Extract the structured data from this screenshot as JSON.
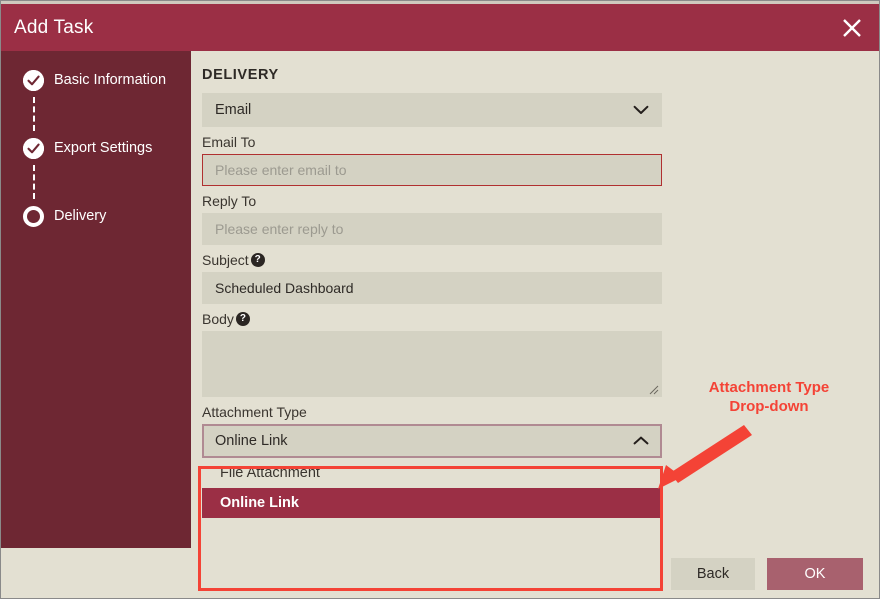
{
  "window": {
    "title": "Add Task",
    "close_icon": "close-icon",
    "bg_ghost_text": "· · ·   · ·"
  },
  "sidebar": {
    "steps": [
      {
        "label": "Basic Information",
        "state": "completed",
        "icon": "check-circle-icon"
      },
      {
        "label": "Export Settings",
        "state": "completed",
        "icon": "check-circle-icon"
      },
      {
        "label": "Delivery",
        "state": "active",
        "icon": "radio-selected-icon"
      }
    ]
  },
  "main": {
    "section_title": "DELIVERY",
    "delivery_method": {
      "name": "delivery-method-select",
      "value": "Email",
      "chevron": "chevron-down-icon"
    },
    "email_to": {
      "label": "Email To",
      "value": "",
      "placeholder": "Please enter email to",
      "error": true
    },
    "reply_to": {
      "label": "Reply To",
      "value": "",
      "placeholder": "Please enter reply to",
      "error": false
    },
    "subject": {
      "label": "Subject",
      "help_icon": "help-icon",
      "value": "Scheduled Dashboard",
      "placeholder": ""
    },
    "body": {
      "label": "Body",
      "help_icon": "help-icon",
      "value": "",
      "placeholder": "",
      "resize_handle": "resize-grip-icon"
    },
    "attachment_type": {
      "label": "Attachment Type",
      "value": "Online Link",
      "chevron": "chevron-up-icon",
      "expanded": true,
      "options": [
        {
          "label": "File Attachment",
          "selected": false
        },
        {
          "label": "Online Link",
          "selected": true
        }
      ]
    }
  },
  "annotation": {
    "text_line1": "Attachment Type",
    "text_line2": "Drop-down",
    "color": "#F44336",
    "arrow_icon": "arrow-pointer-icon"
  },
  "footer": {
    "back_label": "Back",
    "ok_label": "OK"
  },
  "colors": {
    "titlebar": "#9B2F45",
    "sidebar": "#6E2733",
    "content_bg": "#E3E0D2",
    "input_bg": "#D4D2C3",
    "accent_selected": "#9B2F45",
    "ok_button": "#A8616E",
    "annotation_red": "#F44336",
    "error_border": "#B03030"
  }
}
